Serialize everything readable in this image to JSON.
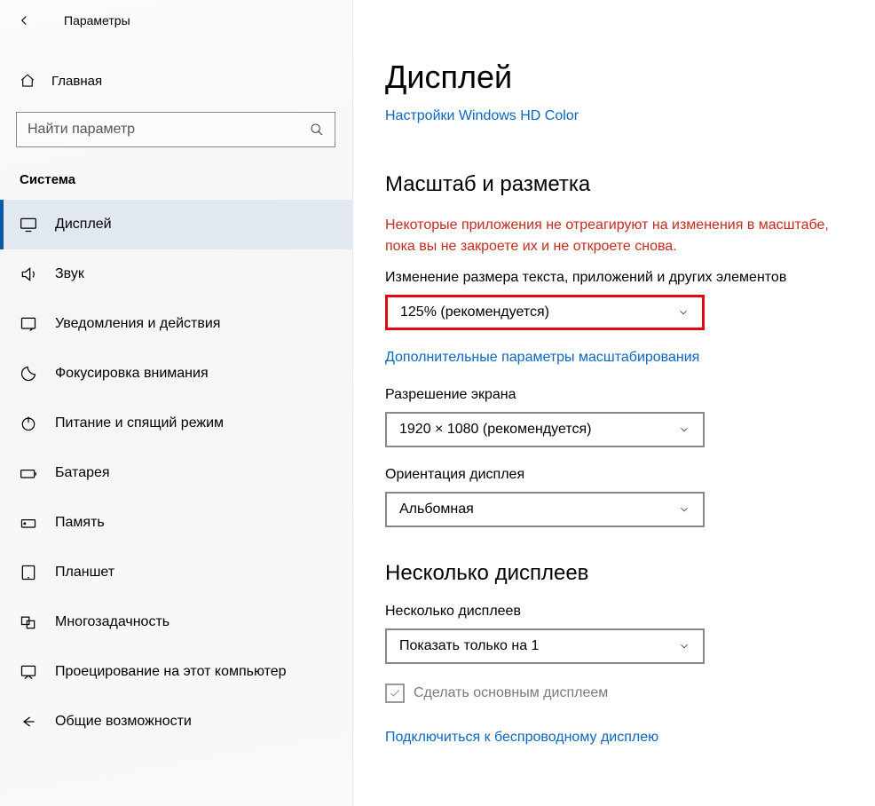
{
  "header": {
    "title": "Параметры"
  },
  "home": {
    "label": "Главная"
  },
  "search": {
    "placeholder": "Найти параметр"
  },
  "section": {
    "title": "Система"
  },
  "nav": [
    {
      "id": "display",
      "label": "Дисплей"
    },
    {
      "id": "sound",
      "label": "Звук"
    },
    {
      "id": "notify",
      "label": "Уведомления и действия"
    },
    {
      "id": "focus",
      "label": "Фокусировка внимания"
    },
    {
      "id": "power",
      "label": "Питание и спящий режим"
    },
    {
      "id": "battery",
      "label": "Батарея"
    },
    {
      "id": "memory",
      "label": "Память"
    },
    {
      "id": "tablet",
      "label": "Планшет"
    },
    {
      "id": "multitask",
      "label": "Многозадачность"
    },
    {
      "id": "project",
      "label": "Проецирование на этот компьютер"
    },
    {
      "id": "shared",
      "label": "Общие возможности"
    }
  ],
  "main": {
    "title": "Дисплей",
    "hdcolor_link": "Настройки Windows HD Color",
    "scale_section": "Масштаб и разметка",
    "warning": "Некоторые приложения не отреагируют на изменения в масштабе, пока вы не закроете их и не откроете снова.",
    "scale_label": "Изменение размера текста, приложений и других элементов",
    "scale_value": "125% (рекомендуется)",
    "adv_scale_link": "Дополнительные параметры масштабирования",
    "res_label": "Разрешение экрана",
    "res_value": "1920 × 1080 (рекомендуется)",
    "orient_label": "Ориентация дисплея",
    "orient_value": "Альбомная",
    "multi_section": "Несколько дисплеев",
    "multi_label": "Несколько дисплеев",
    "multi_value": "Показать только на 1",
    "primary_check": "Сделать основным дисплеем",
    "wireless_link": "Подключиться к беспроводному дисплею"
  }
}
